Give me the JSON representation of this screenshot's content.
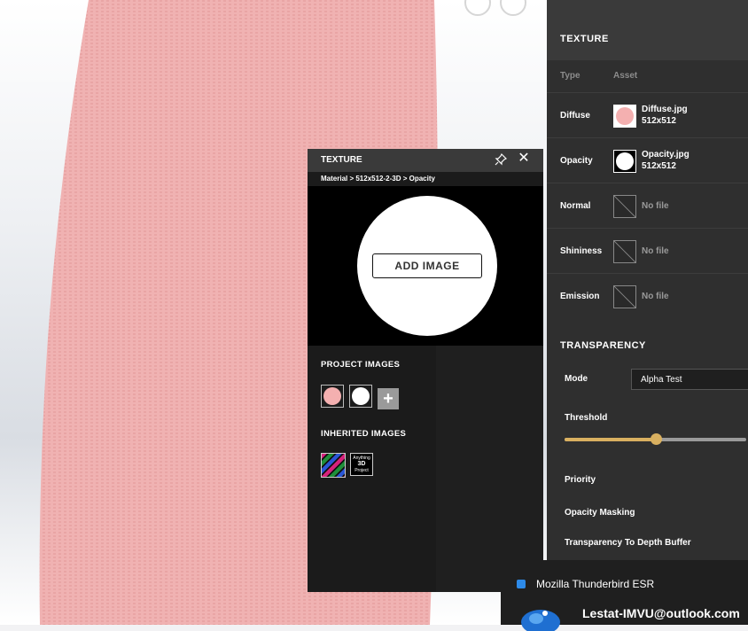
{
  "texture_panel": {
    "title": "TEXTURE",
    "columns": {
      "type": "Type",
      "asset": "Asset"
    },
    "rows": [
      {
        "label": "Diffuse",
        "file": "Diffuse.jpg",
        "size": "512x512",
        "color": "#f4b0b0"
      },
      {
        "label": "Opacity",
        "file": "Opacity.jpg",
        "size": "512x512",
        "color": "#ffffff"
      },
      {
        "label": "Normal",
        "nofile": "No file"
      },
      {
        "label": "Shininess",
        "nofile": "No file"
      },
      {
        "label": "Emission",
        "nofile": "No file"
      }
    ]
  },
  "transparency": {
    "title": "TRANSPARENCY",
    "mode_label": "Mode",
    "mode_value": "Alpha Test",
    "threshold_label": "Threshold",
    "threshold_value": 0.5,
    "priority_label": "Priority",
    "opacity_masking_label": "Opacity Masking",
    "depth_buffer_label": "Transparency To Depth Buffer"
  },
  "popup": {
    "title": "TEXTURE",
    "breadcrumb": "Material > 512x512-2-3D > Opacity",
    "add_image_label": "ADD IMAGE",
    "project_images_label": "PROJECT IMAGES",
    "inherited_images_label": "INHERITED IMAGES",
    "project_thumbs": [
      "#f4b0b0",
      "#ffffff"
    ],
    "anything3d": {
      "line1": "Anything",
      "line2": "3D",
      "line3": "Project"
    }
  },
  "notification": {
    "app": "Mozilla Thunderbird ESR",
    "account": "Lestat-IMVU@outlook.com"
  },
  "colors": {
    "accent": "#d9b060",
    "shape_pink": "#f0b2b2"
  }
}
